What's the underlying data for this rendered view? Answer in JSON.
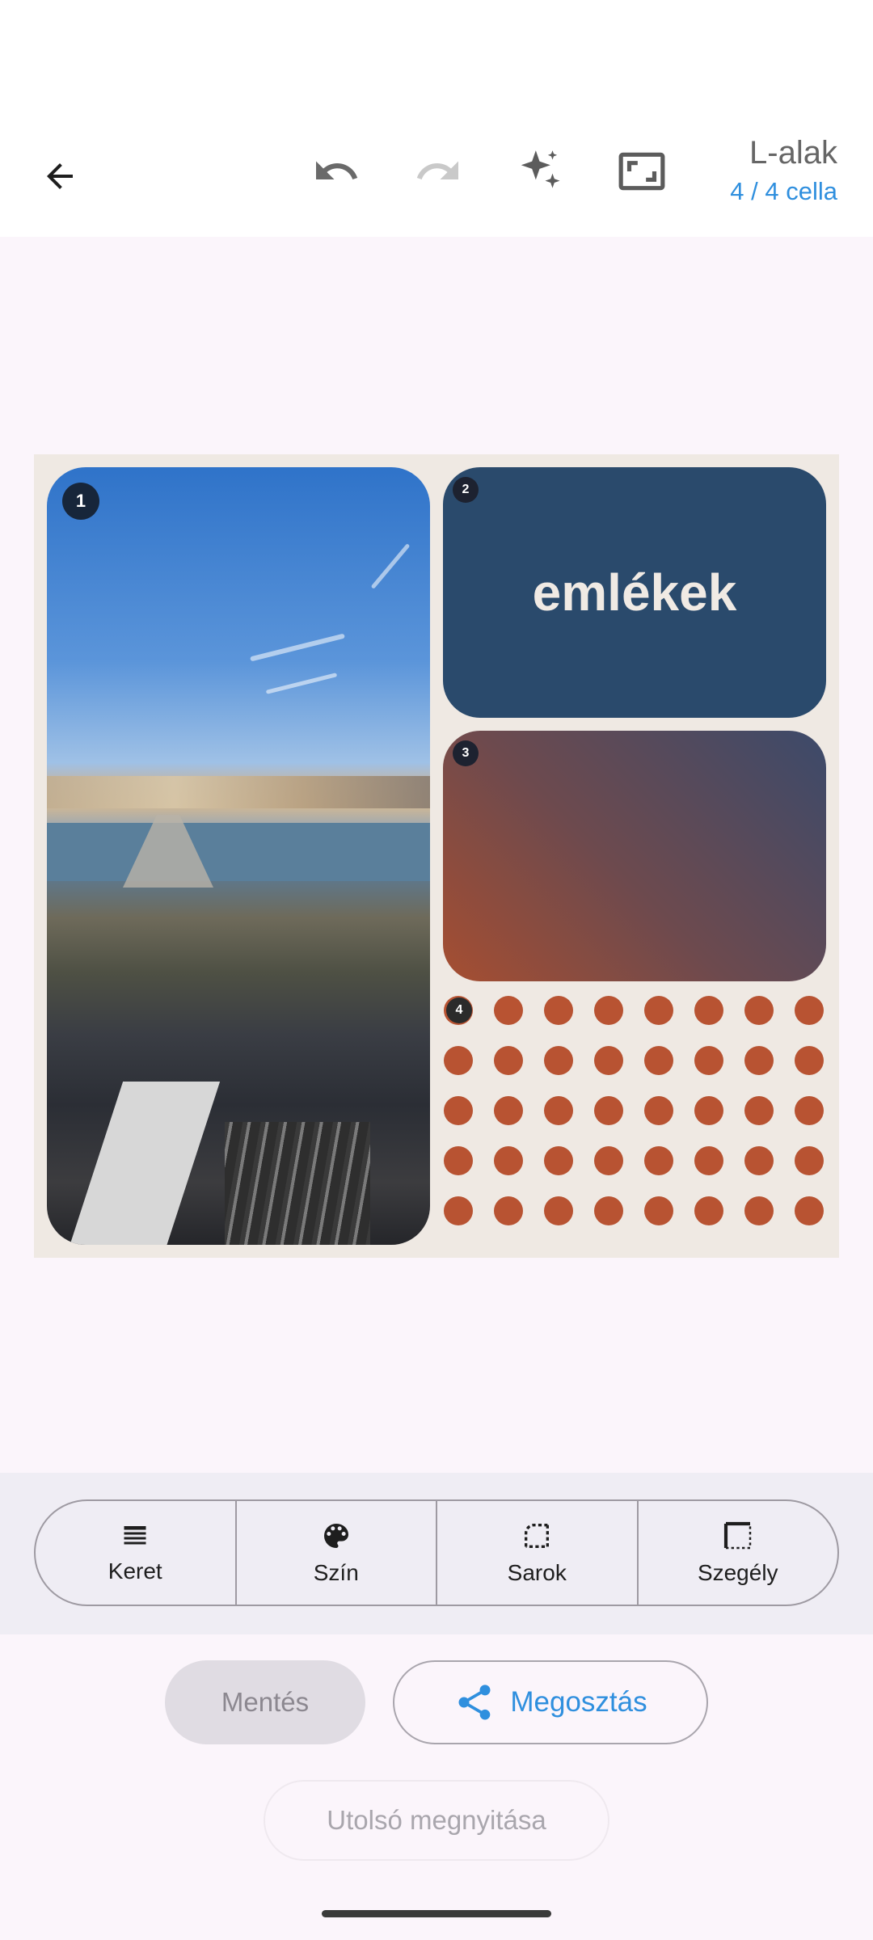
{
  "header": {
    "layout_name": "L-alak",
    "cell_count": "4 / 4 cella",
    "icons": [
      "back-arrow-icon",
      "undo-icon",
      "redo-icon",
      "sparkles-icon",
      "aspect-ratio-icon"
    ]
  },
  "collage": {
    "cells": [
      {
        "number": "1",
        "content": "photo"
      },
      {
        "number": "2",
        "text": "emlékek",
        "color": "#2a4a6c"
      },
      {
        "number": "3",
        "gradient": [
          "#a64e31",
          "#3c4a6a"
        ]
      },
      {
        "number": "4",
        "pattern": "dots",
        "dot_color": "#b85332"
      }
    ],
    "background_color": "#efe9e3"
  },
  "tools": [
    {
      "label": "Keret",
      "icon": "frame-lines-icon"
    },
    {
      "label": "Szín",
      "icon": "palette-icon"
    },
    {
      "label": "Sarok",
      "icon": "corner-icon"
    },
    {
      "label": "Szegély",
      "icon": "border-icon"
    }
  ],
  "actions": {
    "save": "Mentés",
    "share": "Megosztás",
    "open_last": "Utolsó megnyitása"
  },
  "colors": {
    "accent": "#2f8fde"
  }
}
